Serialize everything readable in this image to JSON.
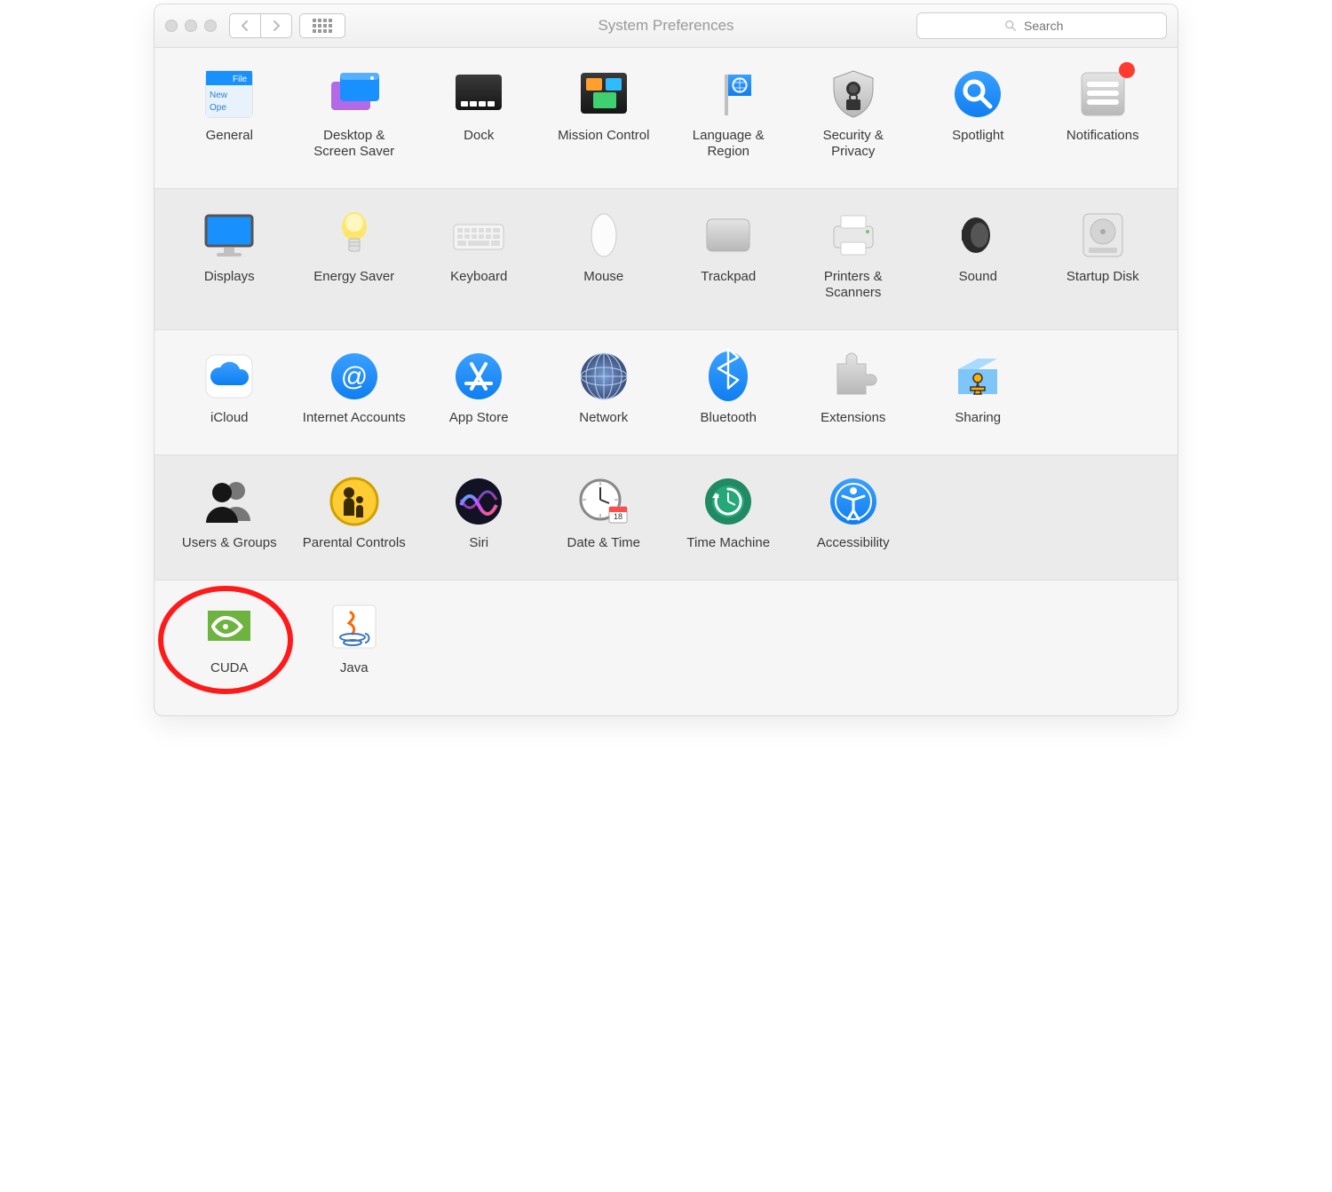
{
  "window": {
    "title": "System Preferences"
  },
  "search": {
    "placeholder": "Search"
  },
  "rows": [
    {
      "alt": false,
      "panes": [
        {
          "id": "general",
          "label": "General",
          "badge": false
        },
        {
          "id": "desktop",
          "label": "Desktop & Screen Saver",
          "badge": false
        },
        {
          "id": "dock",
          "label": "Dock",
          "badge": false
        },
        {
          "id": "mission",
          "label": "Mission Control",
          "badge": false
        },
        {
          "id": "language",
          "label": "Language & Region",
          "badge": false
        },
        {
          "id": "security",
          "label": "Security & Privacy",
          "badge": false
        },
        {
          "id": "spotlight",
          "label": "Spotlight",
          "badge": false
        },
        {
          "id": "notifications",
          "label": "Notifications",
          "badge": true
        }
      ]
    },
    {
      "alt": true,
      "panes": [
        {
          "id": "displays",
          "label": "Displays",
          "badge": false
        },
        {
          "id": "energy",
          "label": "Energy Saver",
          "badge": false
        },
        {
          "id": "keyboard",
          "label": "Keyboard",
          "badge": false
        },
        {
          "id": "mouse",
          "label": "Mouse",
          "badge": false
        },
        {
          "id": "trackpad",
          "label": "Trackpad",
          "badge": false
        },
        {
          "id": "printers",
          "label": "Printers & Scanners",
          "badge": false
        },
        {
          "id": "sound",
          "label": "Sound",
          "badge": false
        },
        {
          "id": "startup",
          "label": "Startup Disk",
          "badge": false
        }
      ]
    },
    {
      "alt": false,
      "panes": [
        {
          "id": "icloud",
          "label": "iCloud",
          "badge": false
        },
        {
          "id": "internet",
          "label": "Internet Accounts",
          "badge": false
        },
        {
          "id": "appstore",
          "label": "App Store",
          "badge": false
        },
        {
          "id": "network",
          "label": "Network",
          "badge": false
        },
        {
          "id": "bluetooth",
          "label": "Bluetooth",
          "badge": false
        },
        {
          "id": "extensions",
          "label": "Extensions",
          "badge": false
        },
        {
          "id": "sharing",
          "label": "Sharing",
          "badge": false
        }
      ]
    },
    {
      "alt": true,
      "panes": [
        {
          "id": "users",
          "label": "Users & Groups",
          "badge": false
        },
        {
          "id": "parental",
          "label": "Parental Controls",
          "badge": false
        },
        {
          "id": "siri",
          "label": "Siri",
          "badge": false
        },
        {
          "id": "datetime",
          "label": "Date & Time",
          "badge": false
        },
        {
          "id": "timemachine",
          "label": "Time Machine",
          "badge": false
        },
        {
          "id": "accessibility",
          "label": "Accessibility",
          "badge": false
        }
      ]
    },
    {
      "alt": false,
      "panes": [
        {
          "id": "cuda",
          "label": "CUDA",
          "badge": false,
          "highlight": true
        },
        {
          "id": "java",
          "label": "Java",
          "badge": false
        }
      ]
    }
  ]
}
